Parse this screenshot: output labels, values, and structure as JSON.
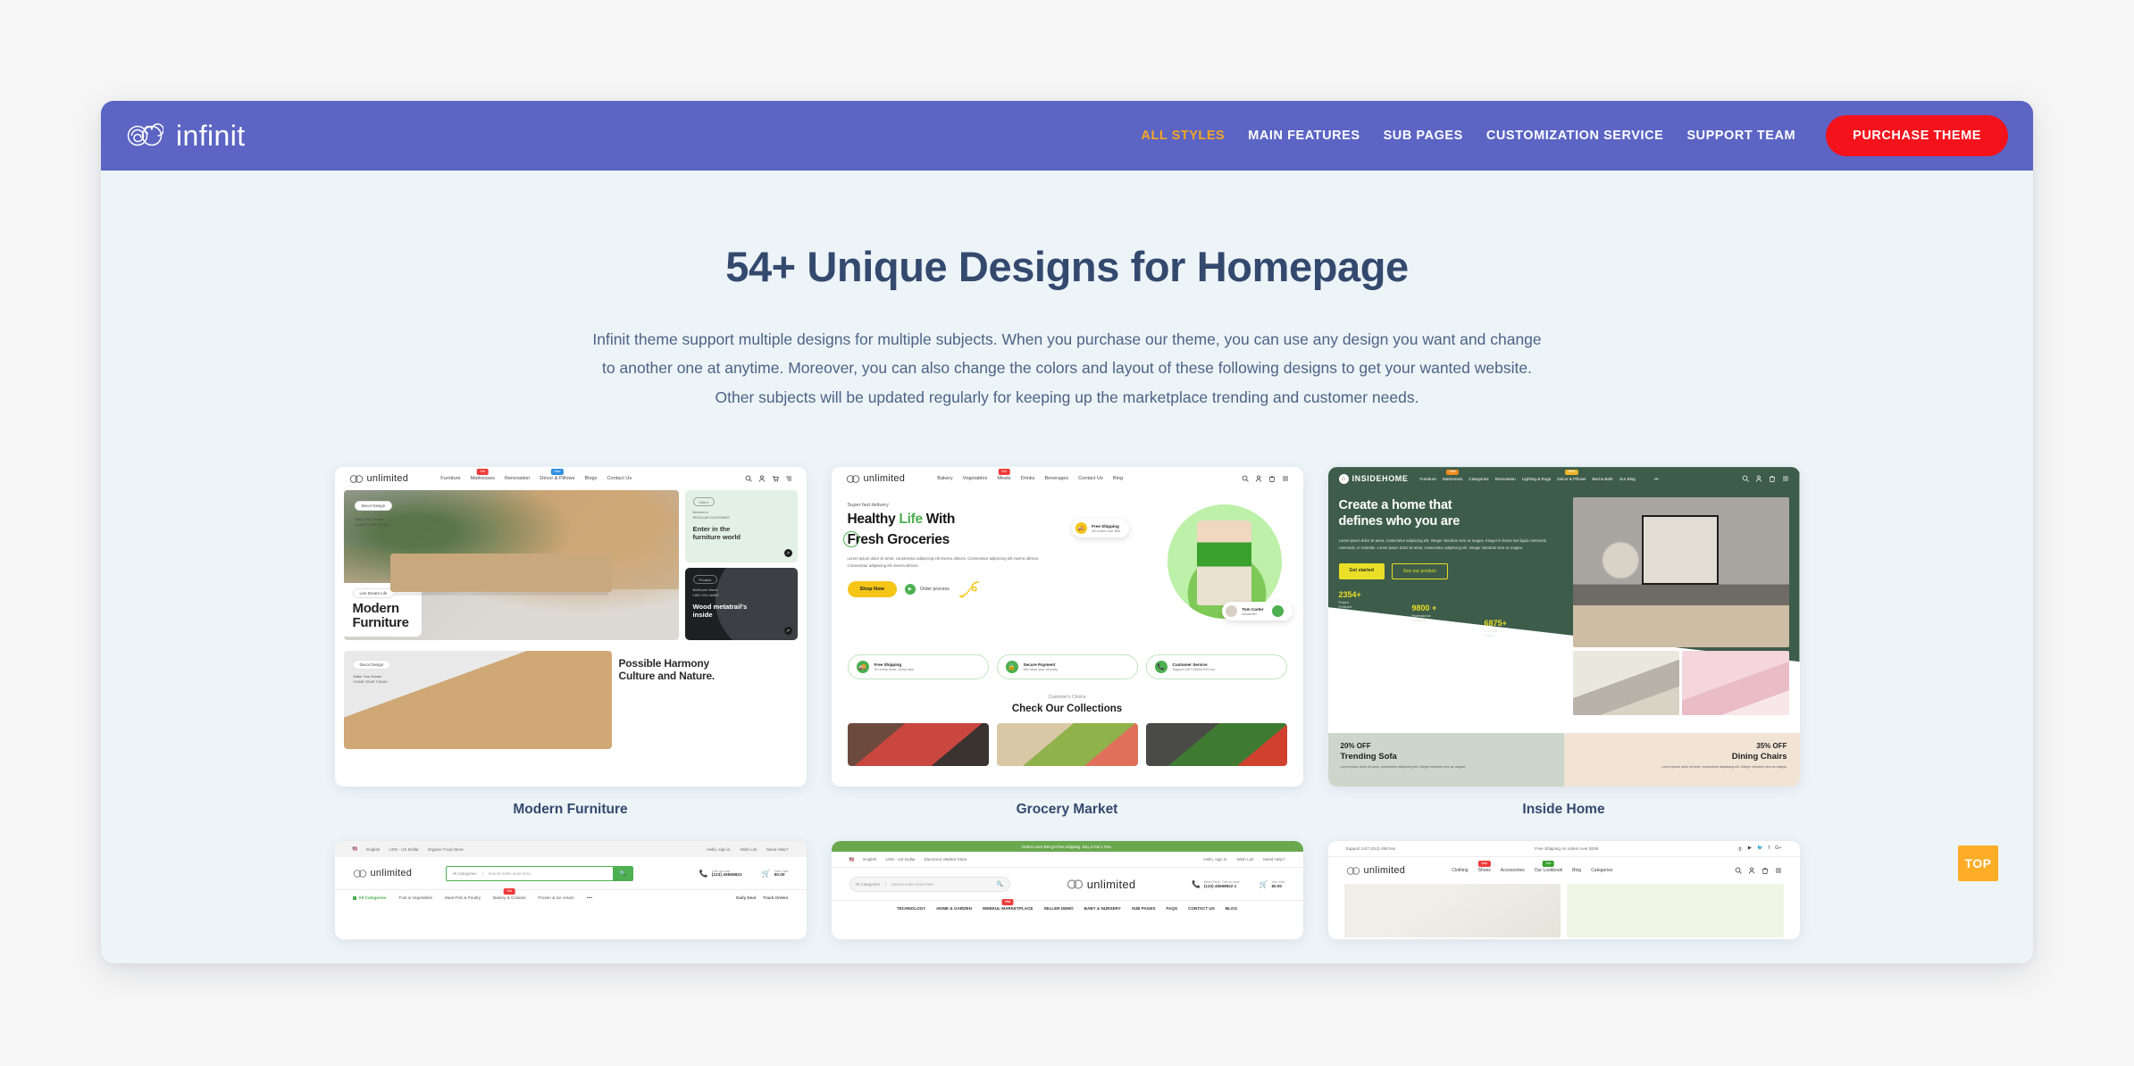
{
  "header": {
    "brand": "infinit",
    "logo_icon": "infinity-spiral-icon",
    "nav": [
      {
        "label": "ALL STYLES",
        "active": true
      },
      {
        "label": "MAIN FEATURES",
        "active": false
      },
      {
        "label": "SUB PAGES",
        "active": false
      },
      {
        "label": "CUSTOMIZATION SERVICE",
        "active": false
      },
      {
        "label": "SUPPORT TEAM",
        "active": false
      }
    ],
    "purchase_button": "PURCHASE THEME",
    "bg_color": "#5c64c4",
    "accent_color": "#f5a623",
    "purchase_color": "#f4121b"
  },
  "hero": {
    "title": "54+ Unique Designs for Homepage",
    "subtitle": "Infinit theme support multiple designs for multiple subjects. When you purchase our theme, you can use any design you want and change to another one at anytime. Moreover, you can also change the colors and layout of these following designs to get your wanted website. Other subjects will be updated regularly for keeping up the marketplace trending and customer needs.",
    "title_color": "#34496e"
  },
  "cards": {
    "furniture": {
      "label": "Modern Furniture",
      "shop_logo": "unlimited",
      "nav": [
        "Furniture",
        "Mattresses",
        "Renovation",
        "Décor & Pillows",
        "Blogs",
        "Contact Us"
      ],
      "nav_badge": "Hot",
      "hero_pill": "Decor Design",
      "hero_kicker": "Make Your Dream",
      "hero_kicker2": "COME TRUE TODAY",
      "hero_pill2": "Live Dream Life",
      "hero_title_l1": "Modern",
      "hero_title_l2": "Furniture",
      "promo1_pill": "Client",
      "promo1_kicker": "Become a",
      "promo1_kicker2": "REGULAR CUSTOMER",
      "promo1_title_l1": "Enter in the",
      "promo1_title_l2": "furniture world",
      "promo2_pill": "Product",
      "promo2_kicker": "Build your Home",
      "promo2_kicker2": "LIKE YOU WANT",
      "promo2_title_l1": "Wood metatrail's",
      "promo2_title_l2": "inside",
      "second_pill": "Decor Design",
      "second_kicker": "Make Your Dream",
      "second_kicker2": "COME TRUE TODAY",
      "second_title_l1": "Possible Harmony",
      "second_title_l2": "Culture and Nature."
    },
    "grocery": {
      "label": "Grocery Market",
      "shop_logo": "unlimited",
      "nav": [
        "Bakery",
        "Vegetables",
        "Meats",
        "Drinks",
        "Beverages",
        "Contact Us",
        "Blog"
      ],
      "nav_badge": "Hot",
      "eyebrow": "Super fast delivery",
      "title_l1_a": "Healthy ",
      "title_l1_b": "Life",
      "title_l1_c": " With",
      "title_l2_a": "F",
      "title_l2_b": "resh Groceries",
      "paragraph": "Lorem ipsum dolor sit amet, consectetur adipiscing elit viverra ultrices. Consectetur adipiscing elit viverra ultrices. Consectetur adipiscing elit viverra ultrices.",
      "shop_button": "Shop Now",
      "play_label": "Order process",
      "float_ship_title": "Free Shipping",
      "float_ship_sub": "All orders over $60",
      "float_person_name": "Tom Carter",
      "float_person_role": "Bestseller",
      "features": [
        {
          "title": "Free Shipping",
          "sub": "On every order, every day!",
          "icon": "truck-icon"
        },
        {
          "title": "Secure Payment",
          "sub": "We value your security",
          "icon": "lock-icon"
        },
        {
          "title": "Customer Service",
          "sub": "Support 24/7 03633-929 xxx",
          "icon": "phone-icon"
        }
      ],
      "collect_eyebrow": "Customer's Choice",
      "collect_title": "Check Our Collections"
    },
    "insidehome": {
      "label": "Inside Home",
      "shop_logo": "INSIDEHOME",
      "nav": [
        "Furniture",
        "Mattresses",
        "Categories",
        "Renovation",
        "Lighting & Rugs",
        "Décor & Pillows",
        "Bed & Bath",
        "Our Blog"
      ],
      "title_l1": "Create a home that",
      "title_l2": "defines who you are",
      "paragraph": "Lorem ipsum dolor sit amet, consectetur adipiscing elit. Integer interdum sem ac magna. Integer in lectus sed ligula commodo commodo, in molestie. Lorem ipsum dolor sit amet, consectetur adipiscing elit. Integer interdum sem ac magna.",
      "btn_primary": "Get started",
      "btn_secondary": "See our product",
      "stats": [
        {
          "number": "2354+",
          "label_l1": "Project",
          "label_l2": "Finished"
        },
        {
          "number": "9800 +",
          "label_l1": "Professional",
          "label_l2": "Designer"
        },
        {
          "number": "6875+",
          "label_l1": "Ongoing",
          "label_l2": "Project"
        }
      ],
      "promo_left_off": "20% OFF",
      "promo_left_title": "Trending Sofa",
      "promo_left_desc": "Lorem ipsum dolor sit amet, consectetur adipiscing elit. Integer interdum sem ac magna.",
      "promo_right_off": "35% OFF",
      "promo_right_title": "Dining Chairs",
      "promo_right_desc": "Lorem ipsum dolor sit amet, consectetur adipiscing elit. Integer interdum sem ac magna."
    },
    "organic": {
      "shop_logo": "unlimited",
      "util_lang": "English",
      "util_currency": "USD - US Dollar",
      "util_store": "Organic Food Store",
      "util_right": [
        "Hello, sign in",
        "Wish List",
        "Need Help?"
      ],
      "search_cat": "All Categories",
      "search_placeholder": "Search entire store here...",
      "phone_label": "Call us now!",
      "phone_number": "(123) 45568822",
      "cart_label": "Your Cart",
      "cart_total": "$0.00",
      "cart_count": "0",
      "cats_all": "All Categories",
      "cats": [
        "Fruit & Vegetables",
        "Meat Fish & Poultry",
        "Bakery & Cookies",
        "Frozen & Ice cream"
      ],
      "cats_badge": "Hot",
      "cats_right": [
        "Daily Deal",
        "Track Orders"
      ]
    },
    "marketplace": {
      "shop_logo": "unlimited",
      "banner": "Orders over $49 get free shipping. Buy 2 Get 1 free.",
      "util_lang": "English",
      "util_currency": "USD - US Dollar",
      "util_store": "Electronic Market Store",
      "util_right": [
        "Hello, sign in",
        "Wish List",
        "Need Help?"
      ],
      "search_cat": "All Categories",
      "search_placeholder": "Search entire store here",
      "phone_label": "Need Help? Call us now!",
      "phone_number": "(123) 45568822 1",
      "cart_label": "Your Cart",
      "cart_total": "$0.00",
      "cart_count": "0",
      "nav": [
        "TECHNOLOGY",
        "HOME & GARDEN",
        "WEBKUL MARKETPLACE",
        "SELLER DEMO",
        "BABY & NURSERY",
        "SUB PAGES",
        "FAQS",
        "CONTACT US",
        "BLOG"
      ],
      "nav_badge": "Hot"
    },
    "fashion": {
      "shop_logo": "unlimited",
      "util_support": "Support 24/7 (012) 456 5xx",
      "util_shipping": "Free Shipping on orders over $199",
      "socials": [
        "behance-icon",
        "youtube-icon",
        "twitter-icon",
        "facebook-icon",
        "google-icon"
      ],
      "nav": [
        "Clothing",
        "Shoes",
        "Accessories",
        "Our Lookbook",
        "Blog",
        "Categories"
      ],
      "badge_sale": "Sale",
      "badge_hot": "Hot"
    }
  },
  "scroll_top": {
    "label": "TOP",
    "color": "#ffac26"
  }
}
